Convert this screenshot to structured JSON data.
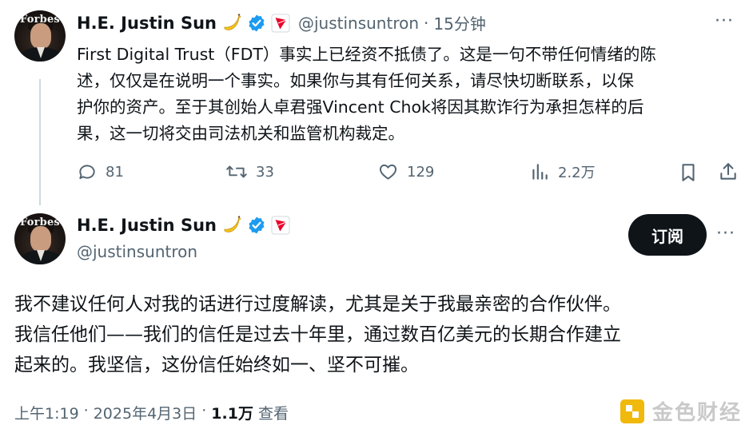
{
  "reply_tweet": {
    "avatar_logo": "Forbes",
    "author_name": "H.E. Justin Sun",
    "handle": "@justinsuntron",
    "separator": "·",
    "time_ago": "15分钟",
    "more_label": "···",
    "text_lines": [
      "First Digital Trust（FDT）事实上已经资不抵债了。这是一句不带任何情绪的陈",
      "述，仅仅是在说明一个事实。如果你与其有任何关系，请尽快切断联系，以保",
      "护你的资产。至于其创始人卓君强Vincent Chok将因其欺诈行为承担怎样的后",
      "果，这一切将交由司法机关和监管机构裁定。"
    ],
    "actions": {
      "replies": "81",
      "reposts": "33",
      "likes": "129",
      "views": "2.2万"
    }
  },
  "main_tweet": {
    "avatar_logo": "Forbes",
    "author_name": "H.E. Justin Sun",
    "handle": "@justinsuntron",
    "subscribe_label": "订阅",
    "more_label": "···",
    "text_lines": [
      "我不建议任何人对我的话进行过度解读，尤其是关于我最亲密的合作伙伴。",
      "我信任他们——我们的信任是过去十年里，通过数百亿美元的长期合作建立",
      "起来的。我坚信，这份信任始终如一、坚不可摧。"
    ],
    "time": "上午1:19",
    "separator": "·",
    "date": "2025年4月3日",
    "views_count": "1.1万",
    "views_label": "查看"
  },
  "watermark": "金色财经",
  "colors": {
    "verified": "#1d9bf0",
    "tron_badge": "#eb0029",
    "text_primary": "#0f1419",
    "text_secondary": "#536471"
  },
  "icons": {
    "emoji": "banana",
    "verified": "verified-badge-icon",
    "affiliate": "tron-logo-badge-icon"
  }
}
